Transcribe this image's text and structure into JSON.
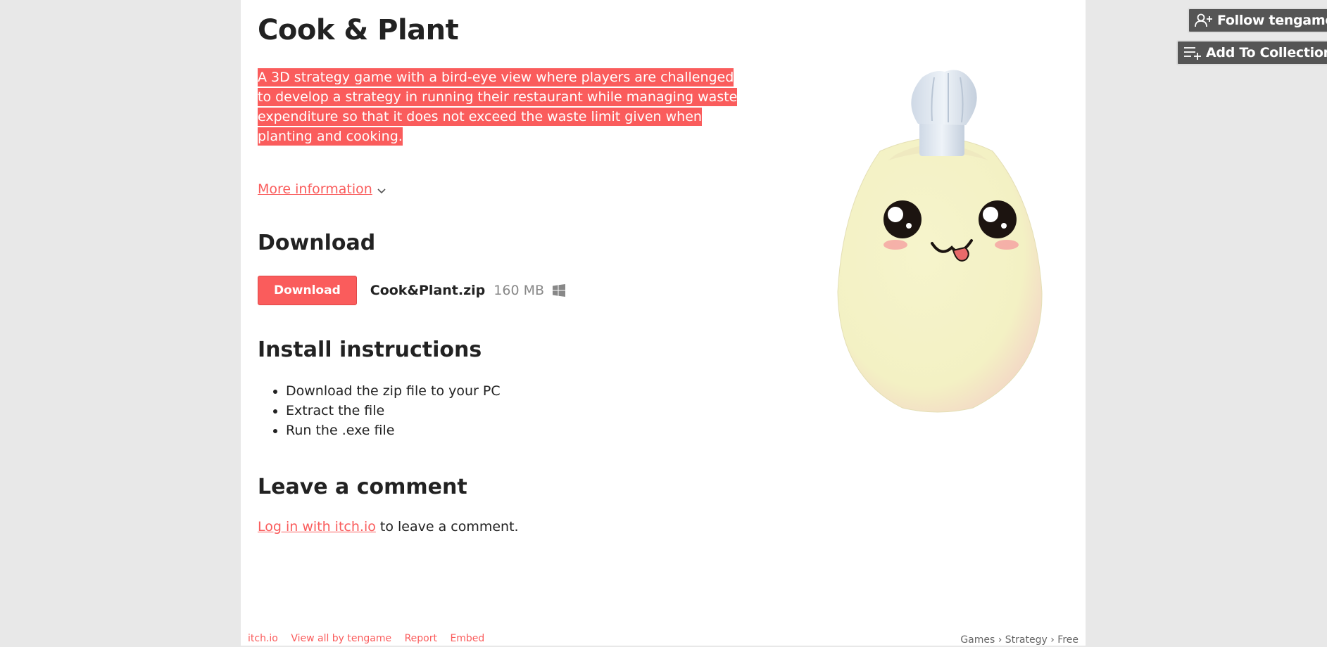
{
  "game": {
    "title": "Cook & Plant",
    "description": "A 3D strategy game with a bird-eye view where players are challenged to develop a strategy in running their restaurant while managing waste expenditure so that it does not exceed the waste limit given when planting and cooking.",
    "more_info_label": "More information"
  },
  "download": {
    "heading": "Download",
    "button_label": "Download",
    "file_name": "Cook&Plant.zip",
    "file_size": "160 MB",
    "platform_icon": "windows-icon"
  },
  "install": {
    "heading": "Install instructions",
    "steps": [
      "Download the zip file to your PC",
      "Extract the file",
      "Run the .exe file"
    ]
  },
  "comments": {
    "heading": "Leave a comment",
    "login_link": "Log in with itch.io",
    "login_suffix": " to leave a comment."
  },
  "side_actions": {
    "follow_label": "Follow tengame",
    "collection_label": "Add To Collection"
  },
  "footer": {
    "links": [
      "itch.io",
      "View all by tengame",
      "Report",
      "Embed"
    ],
    "breadcrumb": "Games › Strategy › Free"
  },
  "colors": {
    "accent": "#fa5c5c",
    "page_bg": "#e8e8e8",
    "content_bg": "#ffffff",
    "side_button_bg": "#555555"
  }
}
